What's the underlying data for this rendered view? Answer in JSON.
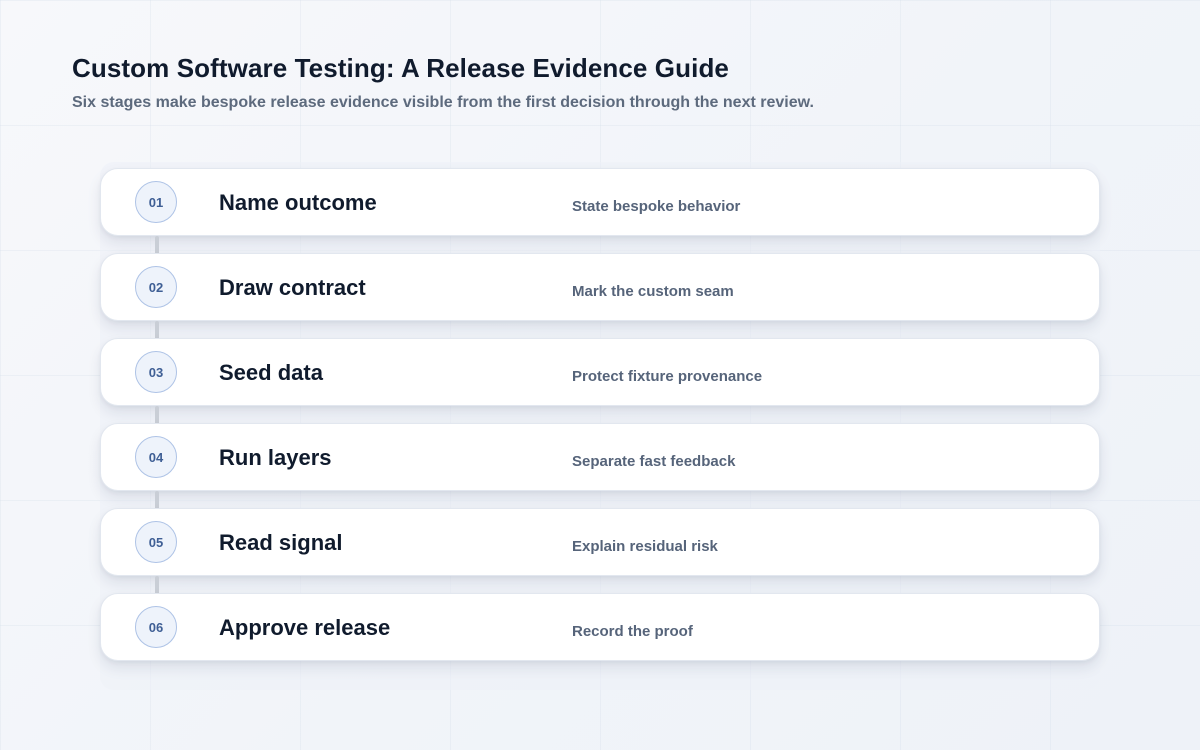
{
  "title": "Custom Software Testing: A Release Evidence Guide",
  "subtitle": "Six stages make bespoke release evidence visible from the first decision through the next review.",
  "steps": [
    {
      "number": "01",
      "title": "Name outcome",
      "description": "State bespoke behavior"
    },
    {
      "number": "02",
      "title": "Draw contract",
      "description": "Mark the custom seam"
    },
    {
      "number": "03",
      "title": "Seed data",
      "description": "Protect fixture provenance"
    },
    {
      "number": "04",
      "title": "Run layers",
      "description": "Separate fast feedback"
    },
    {
      "number": "05",
      "title": "Read signal",
      "description": "Explain residual risk"
    },
    {
      "number": "06",
      "title": "Approve release",
      "description": "Record the proof"
    }
  ],
  "colors": {
    "badge_border": "#aec3e6",
    "badge_text": "#3f5f95",
    "title_text": "#101b2d",
    "connector": "#c9ced6"
  }
}
